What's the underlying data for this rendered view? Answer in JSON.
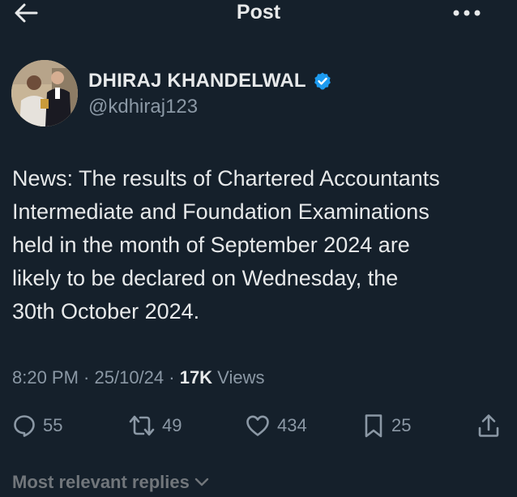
{
  "header": {
    "title": "Post",
    "back_icon": "arrow-left-icon",
    "more_icon": "more-horizontal-icon"
  },
  "author": {
    "display_name": "DHIRAJ KHANDELWAL",
    "handle": "@kdhiraj123",
    "verified": true,
    "verified_color": "#1d9bf0",
    "avatar_icon": "avatar-photo"
  },
  "tweet": {
    "text": "News: The results of Chartered Accountants\nIntermediate and Foundation Examinations\nheld in the month of September 2024 are\nlikely to be declared on Wednesday, the\n30th October 2024."
  },
  "meta": {
    "time": "8:20 PM",
    "separator": " · ",
    "date": "25/10/24",
    "views_count": "17K",
    "views_label": " Views"
  },
  "actions": {
    "replies": "55",
    "reposts": "49",
    "likes": "434",
    "bookmarks": "25"
  },
  "replies_filter": {
    "label": "Most relevant replies"
  },
  "colors": {
    "background": "#15202b",
    "text": "#e7e9ea",
    "muted": "#8b98a5",
    "accent": "#1d9bf0"
  }
}
